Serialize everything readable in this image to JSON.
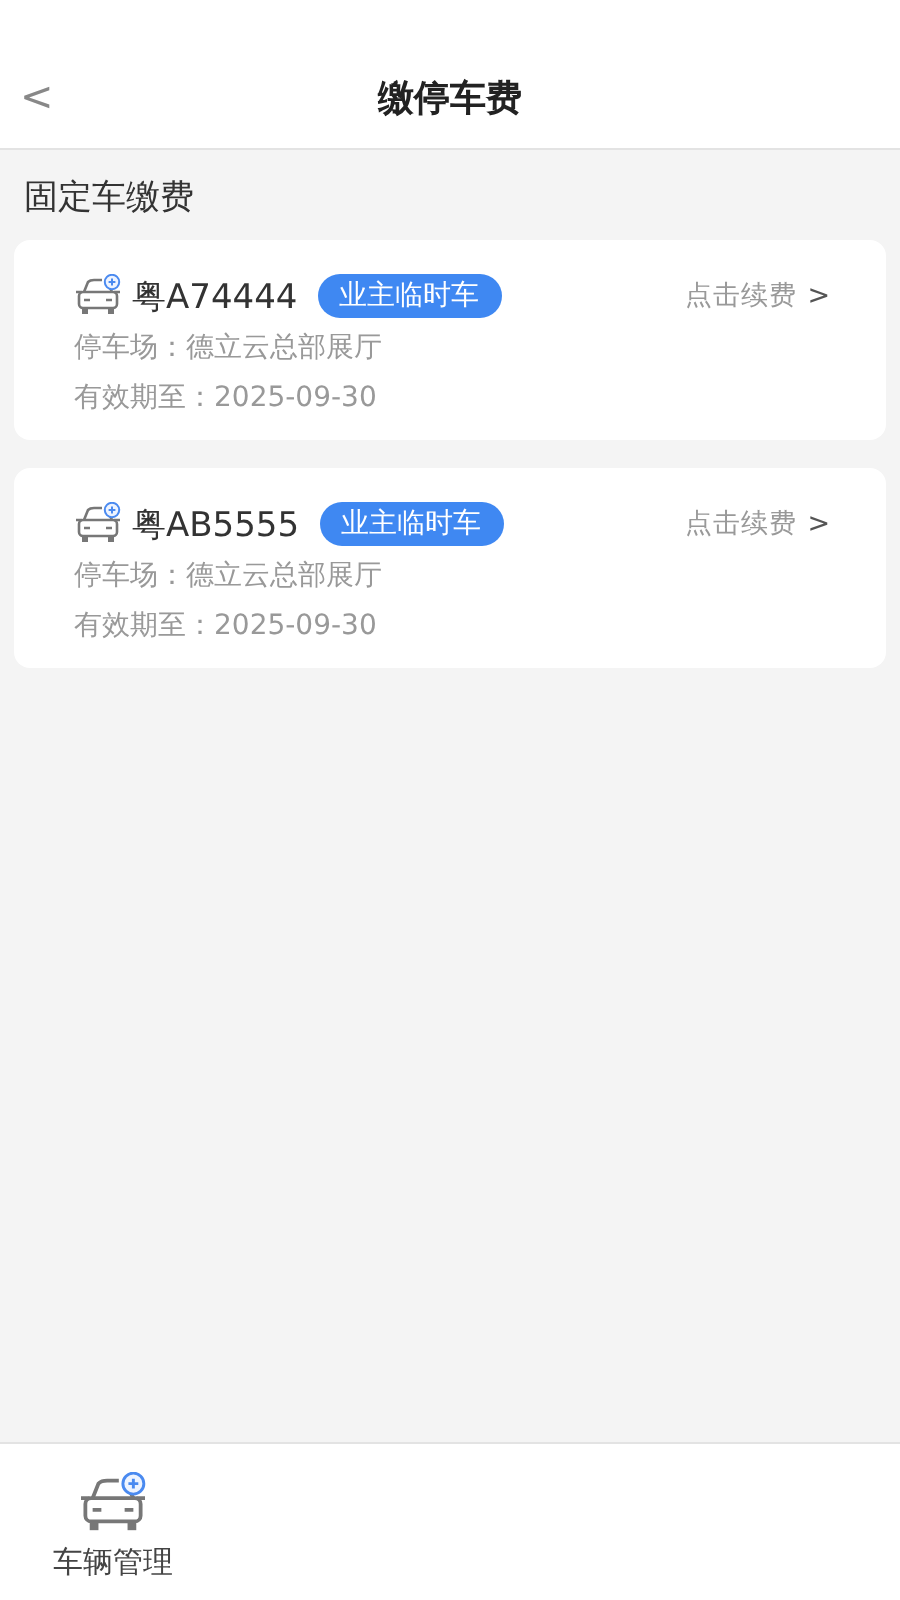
{
  "header": {
    "back": "<",
    "title": "缴停车费"
  },
  "section": {
    "title": "固定车缴费"
  },
  "cards": [
    {
      "plate": "粤A74444",
      "tag": "业主临时车",
      "action": "点击续费",
      "action_arrow": ">",
      "lot": "停车场：德立云总部展厅",
      "expiry": "有效期至：2025-09-30"
    },
    {
      "plate": "粤AB5555",
      "tag": "业主临时车",
      "action": "点击续费",
      "action_arrow": ">",
      "lot": "停车场：德立云总部展厅",
      "expiry": "有效期至：2025-09-30"
    }
  ],
  "tab_bar": {
    "tabs": [
      {
        "label": "车辆管理",
        "kind": "car"
      }
    ]
  }
}
